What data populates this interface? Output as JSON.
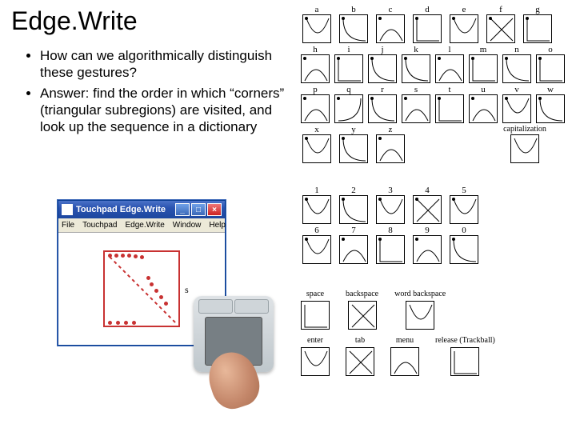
{
  "title": "Edge.Write",
  "bullets": [
    "How can we algorithmically distinguish these gestures?",
    "Answer: find the order in which “corners” (triangular subregions) are visited, and look up the sequence in a dictionary"
  ],
  "window": {
    "title": "Touchpad Edge.Write",
    "menus": [
      "File",
      "Touchpad",
      "Edge.Write",
      "Window",
      "Help"
    ],
    "gesture_letter": "s",
    "btn_min": "_",
    "btn_max": "□",
    "btn_close": "×"
  },
  "glyph_rows": [
    [
      "a",
      "b",
      "c",
      "d",
      "e",
      "f",
      "g"
    ],
    [
      "h",
      "i",
      "j",
      "k",
      "l",
      "m",
      "n",
      "o"
    ],
    [
      "p",
      "q",
      "r",
      "s",
      "t",
      "u",
      "v",
      "w"
    ],
    [
      "x",
      "y",
      "z",
      "",
      "",
      "capitalization"
    ]
  ],
  "digit_rows": [
    [
      "1",
      "2",
      "3",
      "4",
      "5"
    ],
    [
      "6",
      "7",
      "8",
      "9",
      "0"
    ]
  ],
  "cmd_row1": [
    "space",
    "backspace",
    "word backspace"
  ],
  "cmd_row2": [
    "enter",
    "tab",
    "menu",
    "release (Trackball)"
  ]
}
